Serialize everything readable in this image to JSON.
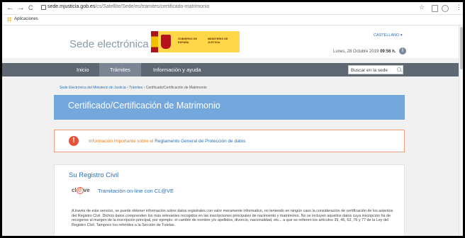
{
  "browser": {
    "url_host": "sede.mjusticia.gob.es",
    "url_path": "/cs/Satellite/Sede/es/tramites/certificado-matrimonio",
    "bookmarks_apps_label": "Aplicaciones",
    "back_glyph": "←",
    "forward_glyph": "→",
    "reload_glyph": "C",
    "star_glyph": "☆",
    "menu_glyph": "⋮"
  },
  "header": {
    "site_title": "Sede electrónica",
    "gov_text_left": "GOBIERNO DE ESPAÑA",
    "gov_text_right": "MINISTERIO DE JUSTICIA",
    "language": "CASTELLANO ▾",
    "date_text": "Lunes, 28 Octubre 2019",
    "time_text": "09:56 h.",
    "info_glyph": "i"
  },
  "nav": {
    "items": [
      "Inicio",
      "Trámites",
      "Información y ayuda"
    ],
    "search_placeholder": "Buscar en la sede"
  },
  "breadcrumb": {
    "crumbs": [
      "Sede Electrónica del Ministerio de Justicia",
      "Trámites"
    ],
    "separator": "›",
    "current": "Certificado/Certificación de Matrimonio"
  },
  "page_title": "Certificado/Certificación de Matrimonio",
  "alert": {
    "glyph": "!",
    "text": "Información importante sobre el",
    "link": "Reglamento General de Protección de datos"
  },
  "registro": {
    "title": "Su Registro Civil",
    "clave_logo_text": "cl",
    "clave_logo_at": "@",
    "clave_logo_end": "ve",
    "clave_link": "Tramitación on-line con CL@VE",
    "body": "A través de este servicio, se puede obtener información sobre datos registrales con valor meramente informativo, no teniendo en ningún caso la consideración de certificación de los asientos del Registro Civil. Dichos datos comprenden los más relevantes recogidos en las inscripciones principales de nacimiento y matrimonio. No se incluyen aquellos datos cuya inscripción ha de recogerse al margen de la inscripción principal, por ejemplo: el cambio de nombre y/o apellidos, divorcio, nacionalidad, etc... a que se refieren los artículos 39, 46, 62, 76 y 77 de la Ley del Registro Civil. Tampoco los referidos a la Sección de Tutelas."
  },
  "colors": {
    "banner": "#74a7dc",
    "navbar": "#5e6873",
    "gov_yellow": "#ffd84a",
    "link": "#2d6fb7",
    "alert_border": "#f19f7a",
    "alert_text": "#e67e22"
  }
}
